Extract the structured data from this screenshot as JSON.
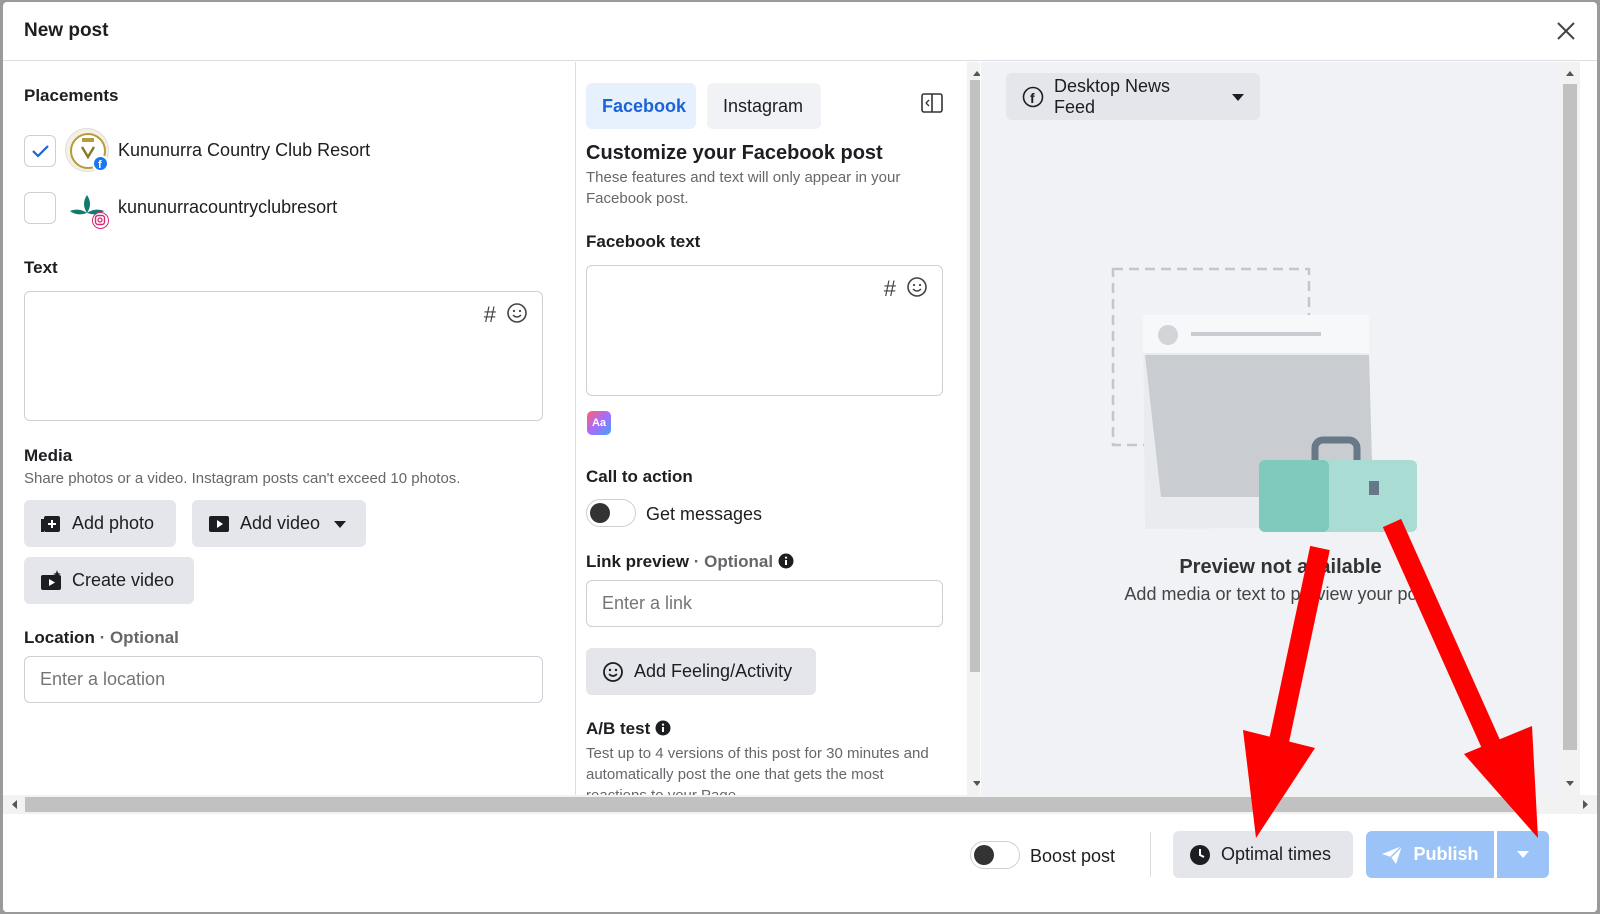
{
  "dialog": {
    "title": "New post"
  },
  "placements": {
    "title": "Placements",
    "items": [
      {
        "label": "Kununurra Country Club Resort",
        "checked": true,
        "network": "facebook"
      },
      {
        "label": "kununurracountryclubresort",
        "checked": false,
        "network": "instagram"
      }
    ]
  },
  "text_section": {
    "title": "Text",
    "hashtag_icon": "hashtag-icon",
    "emoji_icon": "emoji-icon"
  },
  "media": {
    "title": "Media",
    "hint": "Share photos or a video. Instagram posts can't exceed 10 photos.",
    "add_photo": "Add photo",
    "add_video": "Add video",
    "create_video": "Create video"
  },
  "location": {
    "title": "Location",
    "optional": "· Optional",
    "placeholder": "Enter a location"
  },
  "customize": {
    "tabs": [
      {
        "label": "Facebook",
        "active": true
      },
      {
        "label": "Instagram",
        "active": false
      }
    ],
    "title": "Customize your Facebook post",
    "description": "These features and text will only appear in your Facebook post.",
    "fb_text_title": "Facebook text",
    "cta_title": "Call to action",
    "cta_toggle_label": "Get messages",
    "link_preview_title": "Link preview",
    "link_preview_optional": "· Optional",
    "link_placeholder": "Enter a link",
    "feeling_button": "Add Feeling/Activity",
    "ab_title": "A/B test",
    "ab_description": "Test up to 4 versions of this post for 30 minutes and automatically post the one that gets the most reactions to your Page."
  },
  "preview": {
    "placement_dropdown": "Desktop News Feed",
    "title": "Preview not available",
    "subtitle": "Add media or text to preview your post."
  },
  "footer": {
    "boost_label": "Boost post",
    "optimal_times": "Optimal times",
    "publish": "Publish"
  },
  "colors": {
    "accent": "#1b63d6",
    "publish_disabled": "#9cc3f7",
    "annotation_arrow": "#ff0000"
  }
}
